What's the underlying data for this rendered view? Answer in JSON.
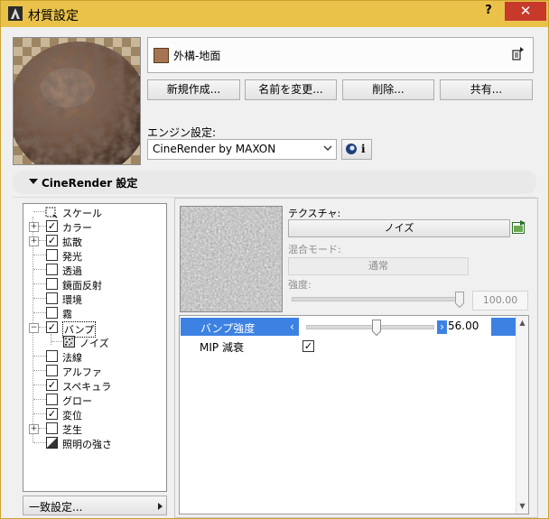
{
  "window": {
    "title": "材質設定",
    "help_label": "?",
    "close_label": "✕"
  },
  "material": {
    "name": "外構-地面",
    "swatch_color": "#a67451"
  },
  "buttons": {
    "new": "新規作成...",
    "rename": "名前を変更...",
    "delete": "削除...",
    "share": "共有..."
  },
  "engine": {
    "label": "エンジン設定:",
    "value": "CineRender by MAXON",
    "info_label": "i"
  },
  "section": {
    "title": "CineRender 設定"
  },
  "tree": {
    "items": [
      {
        "label": "スケール",
        "checked": null,
        "expandable": false
      },
      {
        "label": "カラー",
        "checked": true,
        "expandable": true
      },
      {
        "label": "拡散",
        "checked": true,
        "expandable": true
      },
      {
        "label": "発光",
        "checked": false,
        "expandable": false
      },
      {
        "label": "透過",
        "checked": false,
        "expandable": false
      },
      {
        "label": "鏡面反射",
        "checked": false,
        "expandable": false
      },
      {
        "label": "環境",
        "checked": false,
        "expandable": false
      },
      {
        "label": "霧",
        "checked": false,
        "expandable": false
      },
      {
        "label": "バンプ",
        "checked": true,
        "expandable": true,
        "expanded": true,
        "selected": true
      },
      {
        "label": "ノイズ",
        "checked": null,
        "expandable": false,
        "child": true
      },
      {
        "label": "法線",
        "checked": false,
        "expandable": false
      },
      {
        "label": "アルファ",
        "checked": false,
        "expandable": false
      },
      {
        "label": "スペキュラ",
        "checked": true,
        "expandable": false
      },
      {
        "label": "グロー",
        "checked": false,
        "expandable": false
      },
      {
        "label": "変位",
        "checked": true,
        "expandable": false
      },
      {
        "label": "芝生",
        "checked": false,
        "expandable": true
      },
      {
        "label": "照明の強さ",
        "checked": null,
        "expandable": false
      }
    ]
  },
  "consistency_button": "一致設定...",
  "texture": {
    "label": "テクスチャ:",
    "name": "ノイズ"
  },
  "blend": {
    "label": "混合モード:",
    "value": "通常"
  },
  "intensity": {
    "label": "強度:",
    "value": "100.00",
    "level": 1.0
  },
  "props": {
    "bump_strength": {
      "label": "バンプ強度",
      "value": "56.00",
      "level": 0.56
    },
    "mip_falloff": {
      "label": "MIP 減衰",
      "checked": true
    }
  }
}
